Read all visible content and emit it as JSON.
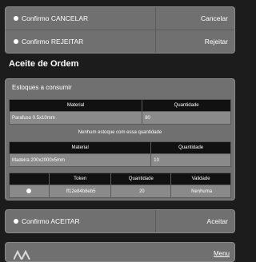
{
  "top_actions": [
    {
      "option": "Confirmo CANCELAR",
      "action": "Cancelar"
    },
    {
      "option": "Confirmo REJEITAR",
      "action": "Rejeitar"
    }
  ],
  "page_title": "Aceite de Ordem",
  "stock_section": {
    "title": "Estoques a consumir",
    "table1": {
      "headers": [
        "Material",
        "Quantidade"
      ],
      "rows": [
        [
          "Parafuso 0.5x10mm",
          "80"
        ]
      ]
    },
    "warning": "Nenhum estoque com essa quantidade",
    "table2": {
      "headers": [
        "Material",
        "Quantidade"
      ],
      "rows": [
        [
          "Madeira 200x2000x5mm",
          "10"
        ]
      ]
    },
    "table3": {
      "headers": [
        "",
        "Token",
        "Quantidade",
        "Validade"
      ],
      "rows": [
        [
          "",
          "ff12e84b8eb5",
          "20",
          "Nenhuma"
        ]
      ]
    }
  },
  "accept": {
    "option": "Confirmo ACEITAR",
    "action": "Aceitar"
  },
  "footer": {
    "menu_label": "Menu"
  }
}
